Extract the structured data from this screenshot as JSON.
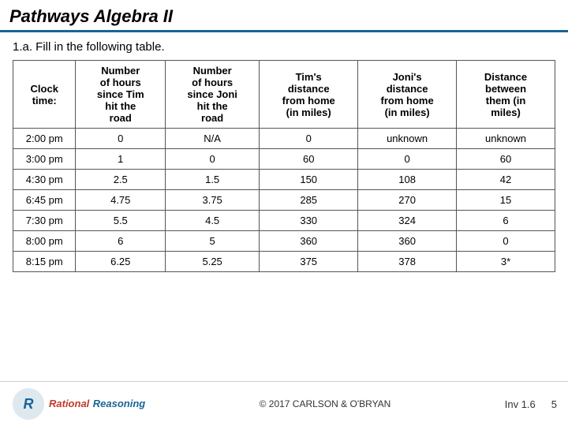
{
  "title": "Pathways Algebra II",
  "instruction": "1.a.  Fill in the following table.",
  "table": {
    "headers": {
      "clock_time": "Clock\ntime:",
      "num_hours_tim_label1": "Number",
      "num_hours_tim_label2": "of hours",
      "num_hours_tim_label3": "since Tim",
      "num_hours_tim_label4": "hit the",
      "num_hours_tim_label5": "road",
      "num_hours_joni_label1": "Number",
      "num_hours_joni_label2": "of hours",
      "num_hours_joni_label3": "since Joni",
      "num_hours_joni_label4": "hit the",
      "num_hours_joni_label5": "road",
      "tims_label1": "Tim's",
      "tims_label2": "distance",
      "tims_label3": "from home",
      "tims_label4": "(in miles)",
      "jonis_label1": "Joni's",
      "jonis_label2": "distance",
      "jonis_label3": "from home",
      "jonis_label4": "(in miles)",
      "dist_label1": "Distance",
      "dist_label2": "between",
      "dist_label3": "them (in",
      "dist_label4": "miles)"
    },
    "rows": [
      {
        "clock": "2:00 pm",
        "tim_hours": "0",
        "joni_hours": "N/A",
        "tims_dist": "0",
        "jonis_dist": "unknown",
        "between": "unknown"
      },
      {
        "clock": "3:00 pm",
        "tim_hours": "1",
        "joni_hours": "0",
        "tims_dist": "60",
        "jonis_dist": "0",
        "between": "60"
      },
      {
        "clock": "4:30 pm",
        "tim_hours": "2.5",
        "joni_hours": "1.5",
        "tims_dist": "150",
        "jonis_dist": "108",
        "between": "42"
      },
      {
        "clock": "6:45 pm",
        "tim_hours": "4.75",
        "joni_hours": "3.75",
        "tims_dist": "285",
        "jonis_dist": "270",
        "between": "15"
      },
      {
        "clock": "7:30 pm",
        "tim_hours": "5.5",
        "joni_hours": "4.5",
        "tims_dist": "330",
        "jonis_dist": "324",
        "between": "6"
      },
      {
        "clock": "8:00 pm",
        "tim_hours": "6",
        "joni_hours": "5",
        "tims_dist": "360",
        "jonis_dist": "360",
        "between": "0"
      },
      {
        "clock": "8:15 pm",
        "tim_hours": "6.25",
        "joni_hours": "5.25",
        "tims_dist": "375",
        "jonis_dist": "378",
        "between": "3*"
      }
    ]
  },
  "footer": {
    "copyright": "© 2017 CARLSON & O'BRYAN",
    "inv_label": "Inv 1.6",
    "page_num": "5",
    "logo_line1": "Rational",
    "logo_line2": "Reasoning"
  }
}
